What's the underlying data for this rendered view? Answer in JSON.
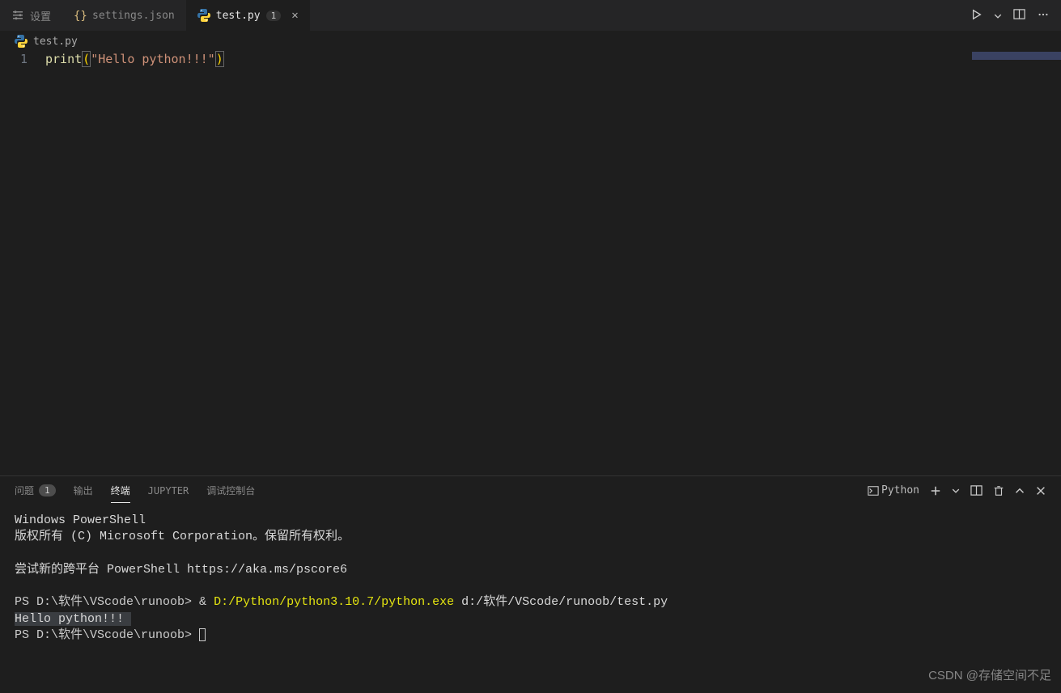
{
  "tabs": [
    {
      "label": "设置",
      "icon": "settings-icon"
    },
    {
      "label": "settings.json",
      "icon": "json-icon"
    },
    {
      "label": "test.py",
      "icon": "python-icon",
      "indicator": "1",
      "active": true,
      "closable": true
    }
  ],
  "breadcrumb": {
    "file": "test.py"
  },
  "editor": {
    "line_number": "1",
    "code": {
      "fn": "print",
      "lparen": "(",
      "string": "\"Hello python!!!\"",
      "rparen": ")"
    }
  },
  "panel": {
    "tabs": {
      "problems": "问题",
      "problems_count": "1",
      "output": "输出",
      "terminal": "终端",
      "jupyter": "JUPYTER",
      "debug_console": "调试控制台"
    },
    "terminal_label": "Python",
    "content": {
      "line1": "Windows PowerShell",
      "line2": "版权所有 (C) Microsoft Corporation。保留所有权利。",
      "line3": "尝试新的跨平台 PowerShell https://aka.ms/pscore6",
      "prompt1_prefix": "PS ",
      "prompt1_path": "D:\\软件\\VScode\\runoob",
      "prompt1_sep": "> & ",
      "cmd_yellow": "D:/Python/python3.10.7/python.exe",
      "cmd_rest": " d:/软件/VScode/runoob/test.py",
      "output_line": "Hello python!!! ",
      "prompt2_prefix": "PS ",
      "prompt2_path": "D:\\软件\\VScode\\runoob",
      "prompt2_sep": "> "
    }
  },
  "watermark": "CSDN @存储空间不足"
}
